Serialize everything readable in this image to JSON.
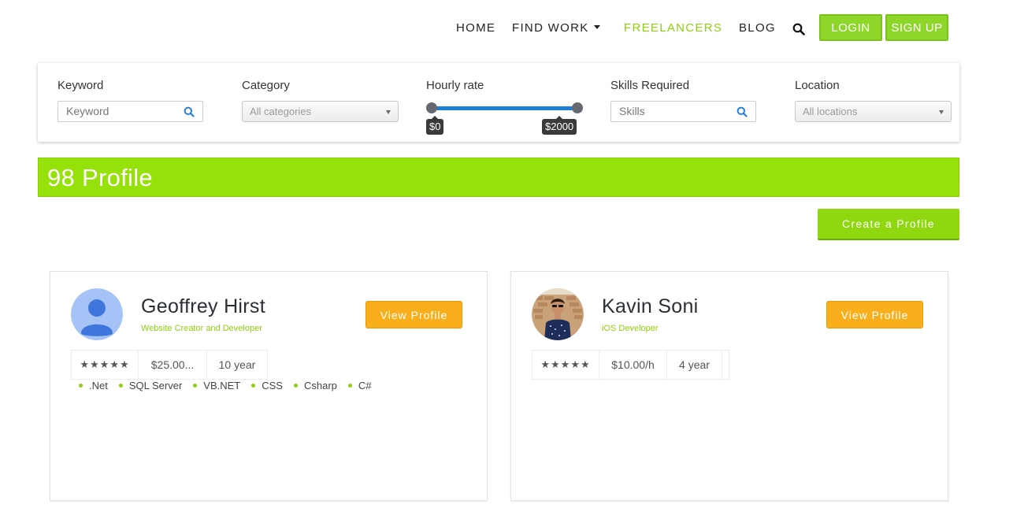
{
  "nav": {
    "home": "HOME",
    "find_work": "FIND WORK",
    "freelancers": "FREELANCERS",
    "blog": "BLOG",
    "login": "LOGIN",
    "signup": "SIGN UP",
    "active_color": "#8fd00f"
  },
  "filters": {
    "keyword": {
      "label": "Keyword",
      "placeholder": "Keyword"
    },
    "category": {
      "label": "Category",
      "value": "All categories"
    },
    "hourly_rate": {
      "label": "Hourly rate",
      "min": "$0",
      "max": "$2000"
    },
    "skills": {
      "label": "Skills Required",
      "placeholder": "Skills"
    },
    "location": {
      "label": "Location",
      "value": "All locations"
    }
  },
  "count_banner": {
    "text": "98 Profile",
    "color": "#96e10a"
  },
  "create_profile_label": "Create a Profile",
  "profiles": [
    {
      "name": "Geoffrey Hirst",
      "role": "Website Creator and Developer",
      "view_label": "View Profile",
      "stars": "★★★★★",
      "rate": "$25.00...",
      "experience": "10 year",
      "skills": [
        ".Net",
        "SQL Server",
        "VB.NET",
        "CSS",
        "Csharp",
        "C#"
      ],
      "avatar_icon": "default-user-icon"
    },
    {
      "name": "Kavin Soni",
      "role": "iOS Developer",
      "view_label": "View Profile",
      "stars": "★★★★★",
      "rate": "$10.00/h",
      "experience": "4 year",
      "skills": [],
      "avatar_icon": "user-photo"
    }
  ]
}
